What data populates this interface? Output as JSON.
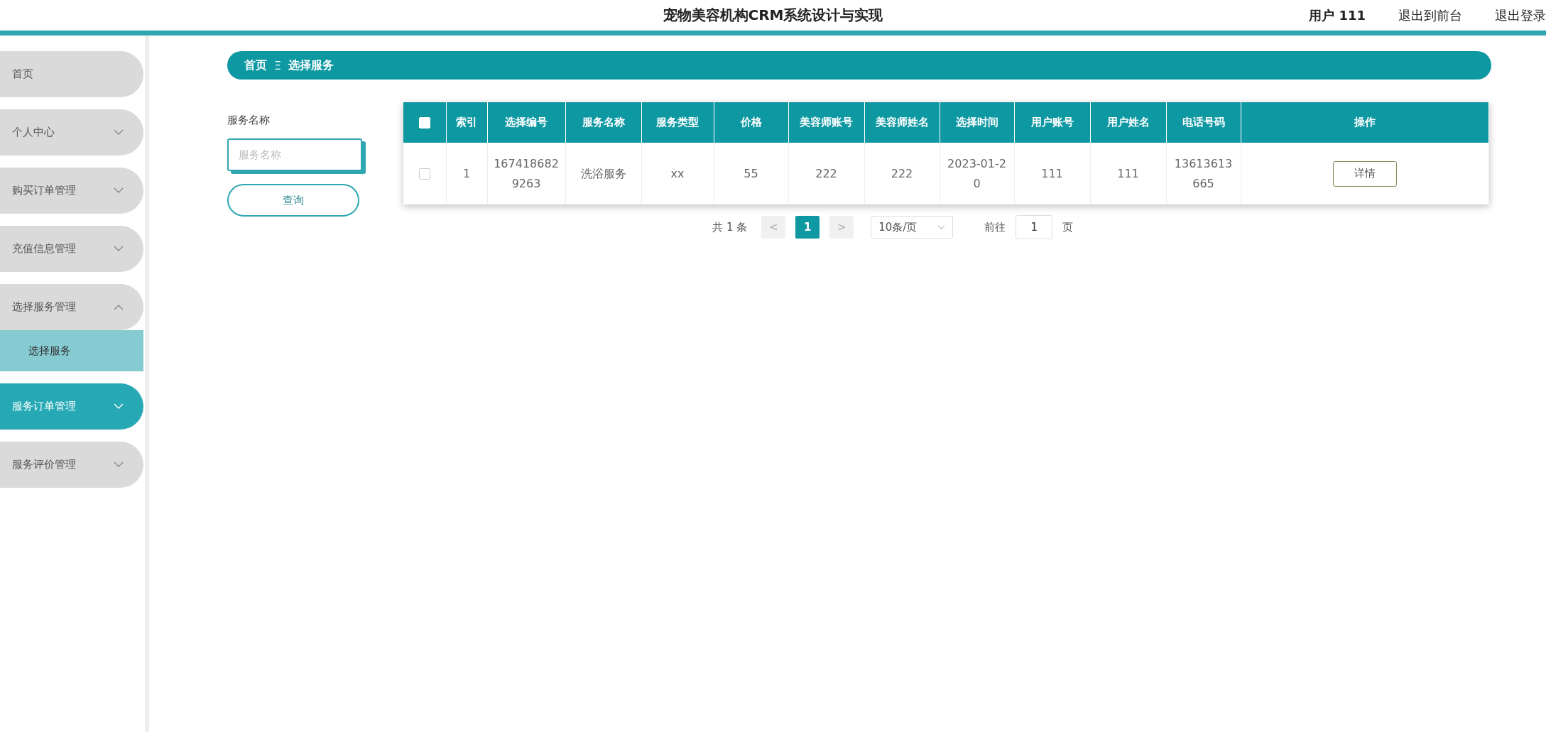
{
  "header": {
    "title": "宠物美容机构CRM系统设计与实现",
    "user": "用户 111",
    "links": [
      "退出到前台",
      "退出登录"
    ]
  },
  "sidebar": {
    "items": [
      {
        "kind": "link",
        "label": "首页",
        "selected": false
      },
      {
        "kind": "submenu",
        "label": "个人中心",
        "selected": false,
        "expanded": false
      },
      {
        "kind": "submenu",
        "label": "购买订单管理",
        "selected": false,
        "expanded": false
      },
      {
        "kind": "submenu",
        "label": "充值信息管理",
        "selected": false,
        "expanded": false
      },
      {
        "kind": "submenu",
        "label": "选择服务管理",
        "selected": false,
        "expanded": true,
        "children": [
          {
            "label": "选择服务",
            "selected": true
          }
        ]
      },
      {
        "kind": "submenu",
        "label": "服务订单管理",
        "selected": true,
        "expanded": false
      },
      {
        "kind": "submenu",
        "label": "服务评价管理",
        "selected": false,
        "expanded": false
      }
    ]
  },
  "breadcrumb": {
    "items": [
      "首页",
      "选择服务"
    ],
    "separator": "Ξ"
  },
  "search": {
    "label": "服务名称",
    "placeholder": "服务名称",
    "button": "查询"
  },
  "table": {
    "header_checkbox": {
      "checked": false
    },
    "columns": [
      "索引",
      "选择编号",
      "服务名称",
      "服务类型",
      "价格",
      "美容师账号",
      "美容师姓名",
      "选择时间",
      "用户账号",
      "用户姓名",
      "电话号码",
      "操作"
    ],
    "rows": [
      {
        "checked": false,
        "cells": [
          "1",
          "1674186829263",
          "洗浴服务",
          "xx",
          "55",
          "222",
          "222",
          "2023-01-20",
          "111",
          "111",
          "13613613665"
        ],
        "action": "详情"
      }
    ]
  },
  "pager": {
    "total": "共 1 条",
    "prev": "<",
    "pages": [
      {
        "label": "1",
        "selected": true
      }
    ],
    "next": ">",
    "page_size": "10条/页",
    "goto": "前往",
    "goto_value": "1",
    "page_unit": "页"
  }
}
